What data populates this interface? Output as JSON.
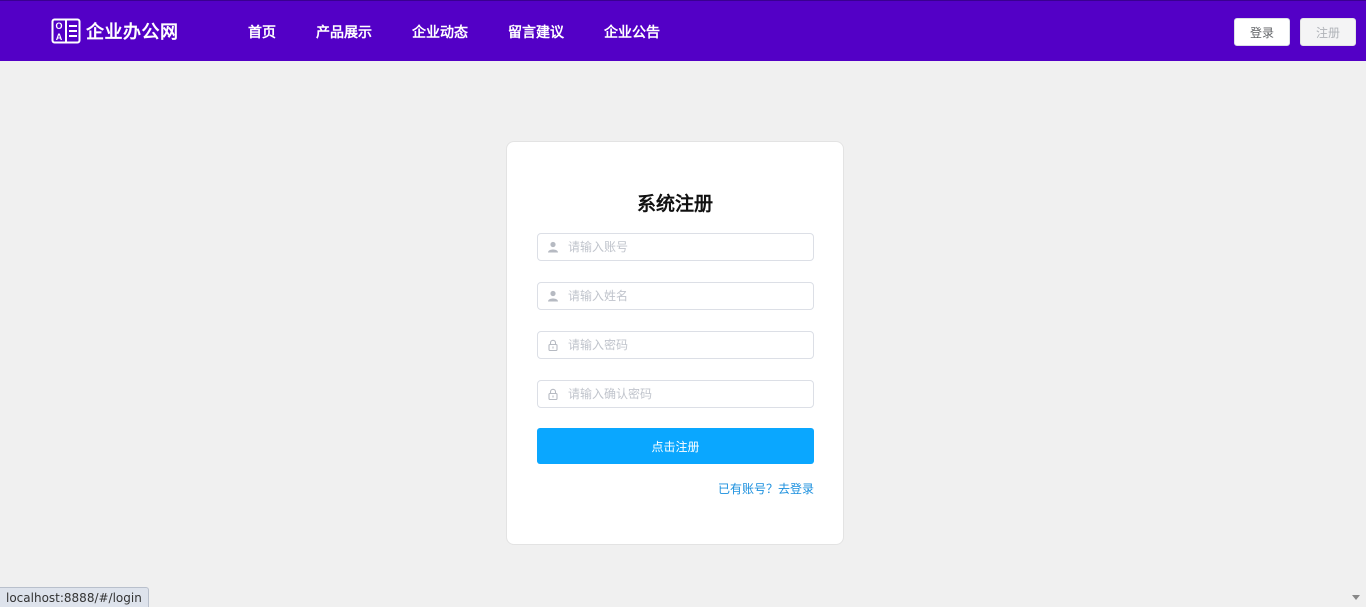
{
  "header": {
    "logo_text": "企业办公网",
    "logo_icon_letters": [
      "O",
      "A"
    ],
    "nav": [
      "首页",
      "产品展示",
      "企业动态",
      "留言建议",
      "企业公告"
    ],
    "login_label": "登录",
    "register_label": "注册"
  },
  "form": {
    "title": "系统注册",
    "fields": [
      {
        "placeholder": "请输入账号",
        "icon": "user-icon"
      },
      {
        "placeholder": "请输入姓名",
        "icon": "user-icon"
      },
      {
        "placeholder": "请输入密码",
        "icon": "lock-icon"
      },
      {
        "placeholder": "请输入确认密码",
        "icon": "lock-icon"
      }
    ],
    "submit_label": "点击注册",
    "login_link": "已有账号？去登录"
  },
  "status_bar": "localhost:8888/#/login",
  "colors": {
    "header_bg": "#5300c6",
    "primary_button": "#0aa7ff",
    "link": "#1a8fde"
  }
}
